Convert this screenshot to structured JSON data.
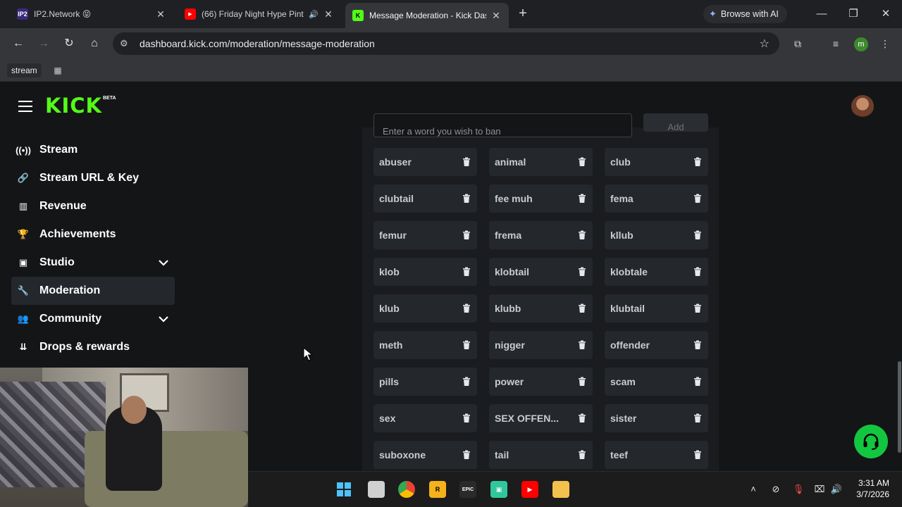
{
  "browser": {
    "tabs": [
      {
        "title": "IP2.Network 😝",
        "favicon": "IP2"
      },
      {
        "title": "(66) Friday Night Hype Pint",
        "favicon": "▶"
      },
      {
        "title": "Message Moderation - Kick Dashboard",
        "favicon": "K"
      }
    ],
    "browse_ai_label": "Browse with AI",
    "url": "dashboard.kick.com/moderation/message-moderation",
    "profile_initial": "m",
    "bookmarks": [
      {
        "label": "stream"
      }
    ]
  },
  "logo": {
    "text": "KICK",
    "badge": "BETA"
  },
  "sidebar": {
    "items": [
      {
        "label": "Stream",
        "icon": "broadcast-icon",
        "active": false,
        "expandable": false
      },
      {
        "label": "Stream URL & Key",
        "icon": "link-icon",
        "active": false,
        "expandable": false
      },
      {
        "label": "Revenue",
        "icon": "chart-icon",
        "active": false,
        "expandable": false
      },
      {
        "label": "Achievements",
        "icon": "trophy-icon",
        "active": false,
        "expandable": false
      },
      {
        "label": "Studio",
        "icon": "studio-icon",
        "active": false,
        "expandable": true
      },
      {
        "label": "Moderation",
        "icon": "wrench-icon",
        "active": true,
        "expandable": false
      },
      {
        "label": "Community",
        "icon": "people-icon",
        "active": false,
        "expandable": true
      },
      {
        "label": "Drops & rewards",
        "icon": "gift-icon",
        "active": false,
        "expandable": false
      }
    ]
  },
  "moderation": {
    "input_placeholder": "Enter a word you wish to ban",
    "add_label": "Add",
    "banned_words": [
      "abuser",
      "animal",
      "club",
      "clubtail",
      "fee muh",
      "fema",
      "femur",
      "frema",
      "kllub",
      "klob",
      "klobtail",
      "klobtale",
      "klub",
      "klubb",
      "klubtail",
      "meth",
      "nigger",
      "offender",
      "pills",
      "power",
      "scam",
      "sex",
      "SEX OFFEN...",
      "sister",
      "suboxone",
      "tail",
      "teef"
    ]
  },
  "taskbar": {
    "clock_time": "3:31 AM",
    "clock_date": "3/7/2026"
  },
  "colors": {
    "brand_green": "#53fc18",
    "page_bg": "#141517",
    "chip_bg": "#24272c",
    "support_green": "#13c640"
  }
}
